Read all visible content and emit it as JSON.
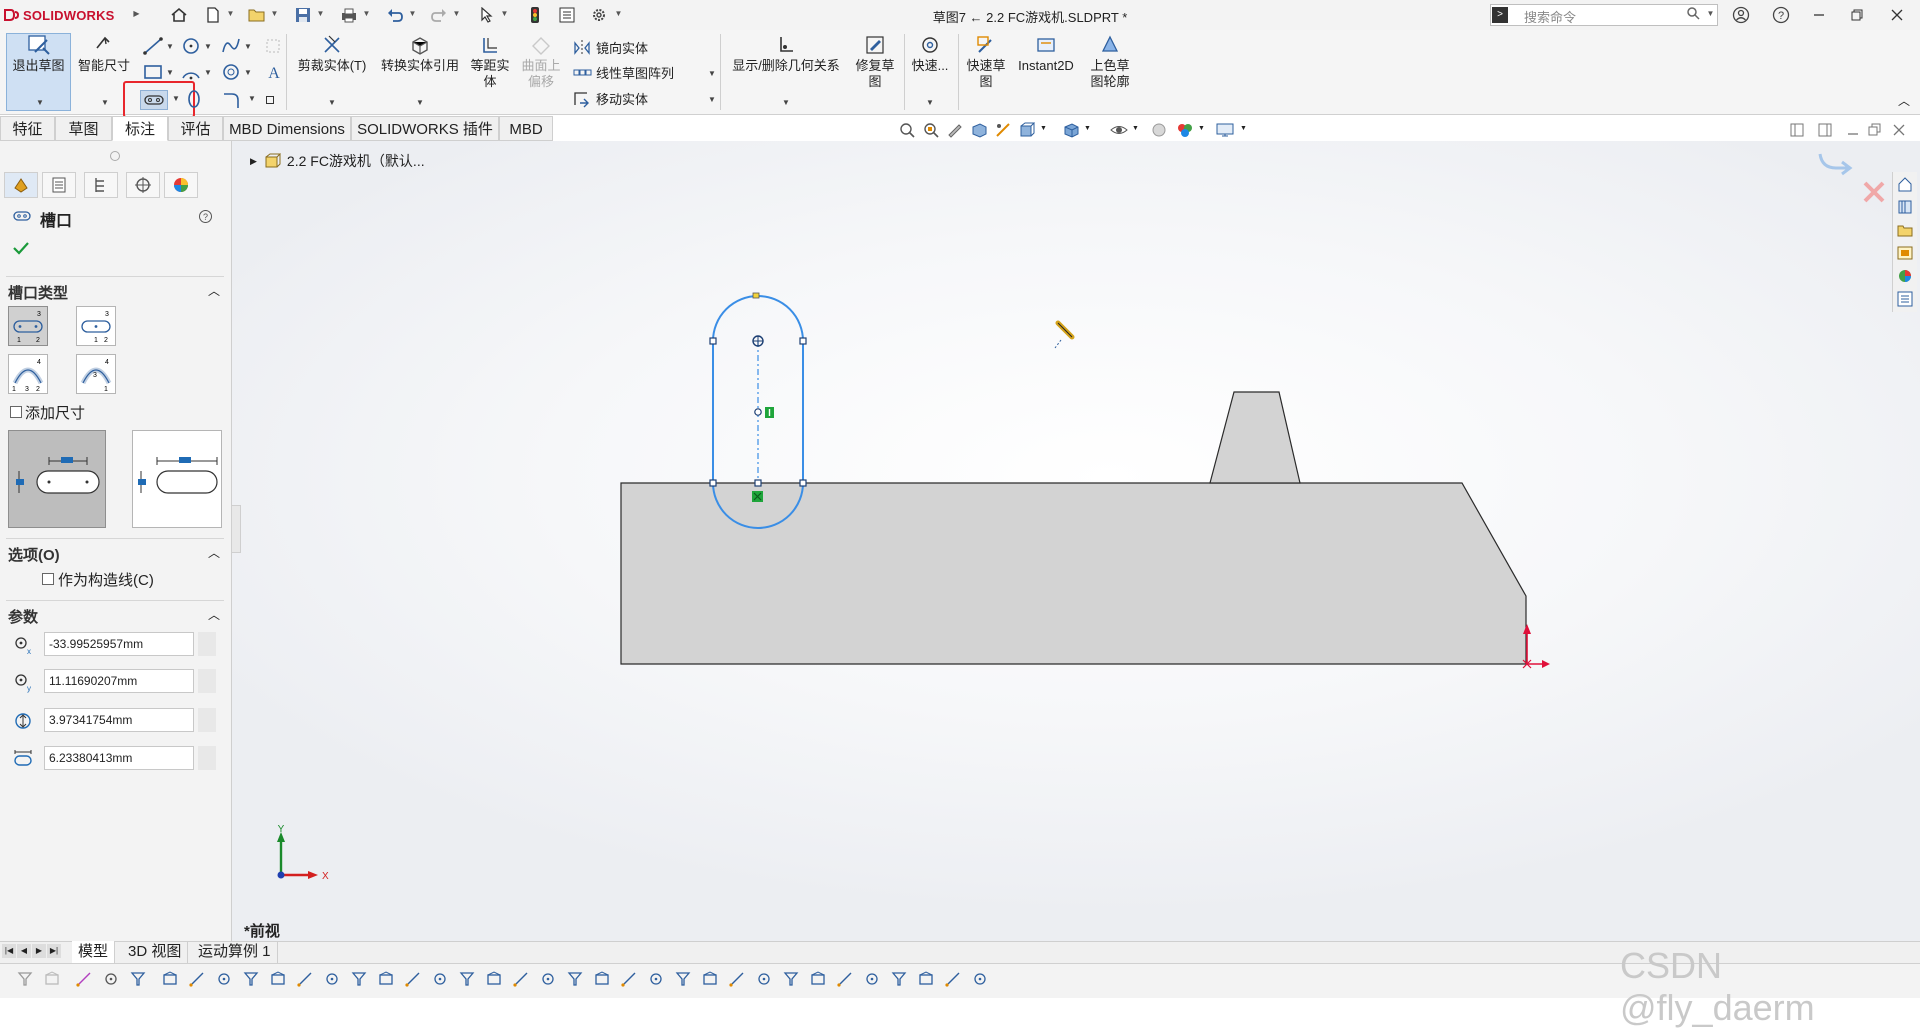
{
  "app": {
    "brand": "SOLIDWORKS"
  },
  "window": {
    "title": "草图7 ← 2.2 FC游戏机.SLDPRT *"
  },
  "search": {
    "placeholder": "搜索命令"
  },
  "ribbon": {
    "exit_sketch": "退出草图",
    "smart_dimension": "智能尺寸",
    "trim_entities": "剪裁实体(T)",
    "convert_entities": "转换实体引用",
    "offset_entities": "等距实",
    "offset_entities_2": "体",
    "offset_surface": "曲面上",
    "offset_surface_2": "偏移",
    "mirror_entities": "镜向实体",
    "linear_pattern": "线性草图阵列",
    "move_entities": "移动实体",
    "display_relations": "显示/删除几何关系",
    "repair_sketch": "修复草",
    "repair_sketch_2": "图",
    "rapid_snap": "快速...",
    "rapid_sketch": "快速草",
    "rapid_sketch_2": "图",
    "instant2d": "Instant2D",
    "shaded_contours": "上色草",
    "shaded_contours_2": "图轮廓"
  },
  "tabs": [
    "特征",
    "草图",
    "标注",
    "评估",
    "MBD Dimensions",
    "SOLIDWORKS 插件",
    "MBD"
  ],
  "tree": {
    "root": "2.2 FC游戏机（默认..."
  },
  "property_manager": {
    "title": "槽口",
    "sections": {
      "slot_type": "槽口类型",
      "add_dimensions": "添加尺寸",
      "options": "选项(O)",
      "construction": "作为构造线(C)",
      "parameters": "参数"
    },
    "params": [
      {
        "icon": "center-x-icon",
        "value": "-33.99525957mm"
      },
      {
        "icon": "center-y-icon",
        "value": "11.11690207mm"
      },
      {
        "icon": "slot-width-icon",
        "value": "3.97341754mm"
      },
      {
        "icon": "slot-length-icon",
        "value": "6.23380413mm"
      }
    ]
  },
  "viewport": {
    "view_name": "*前视"
  },
  "bottom_tabs": [
    "模型",
    "3D 视图",
    "运动算例 1"
  ],
  "watermark": "CSDN @fly_daerm",
  "colors": {
    "sketch_blue": "#3a8ee6",
    "highlight_red": "#e8262c",
    "part_gray": "#d3d3d3",
    "relation_green": "#1fa53b"
  }
}
